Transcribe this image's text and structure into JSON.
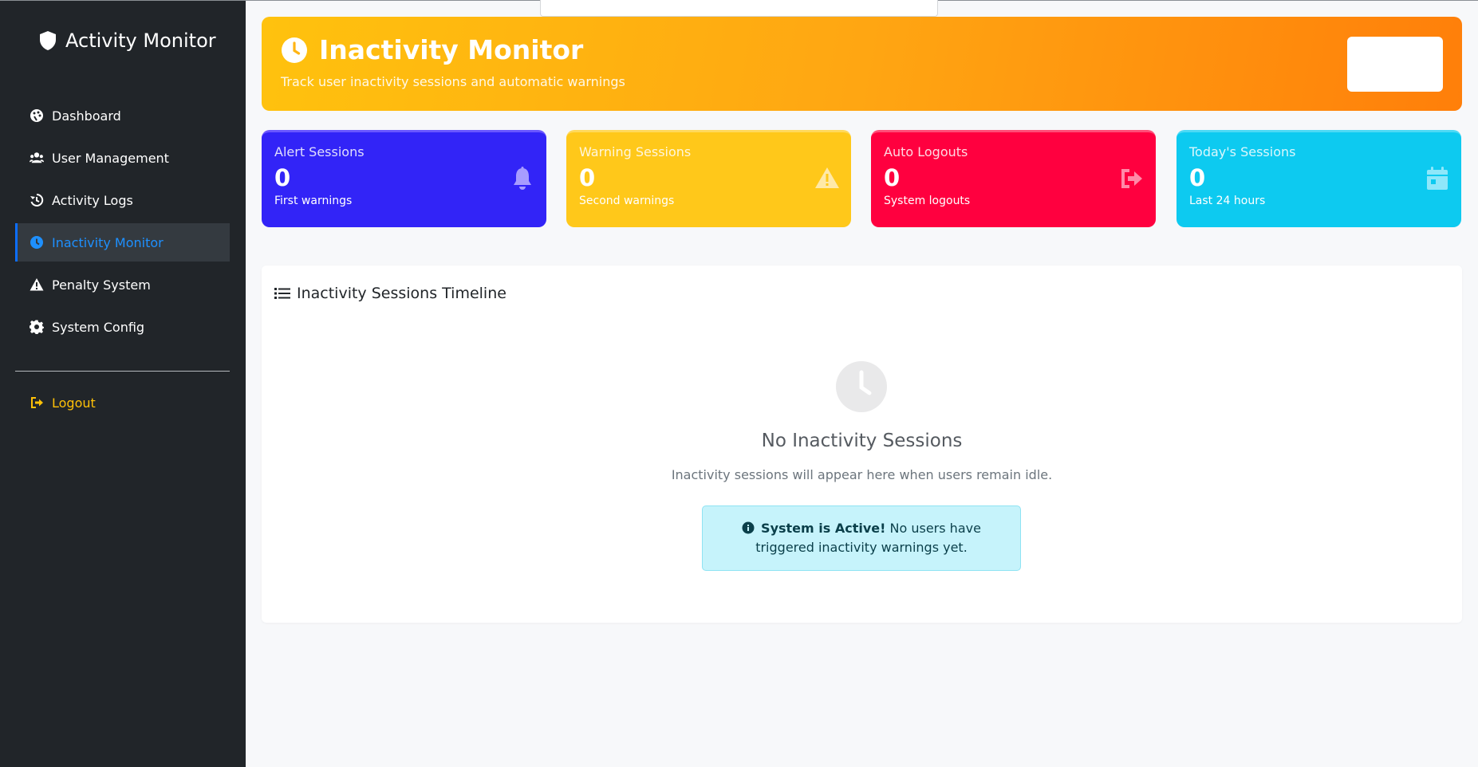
{
  "sidebar": {
    "brand": "Activity Monitor",
    "items": [
      {
        "label": "Dashboard",
        "icon": "palette-dashboard-icon"
      },
      {
        "label": "User Management",
        "icon": "users-icon"
      },
      {
        "label": "Activity Logs",
        "icon": "history-icon"
      },
      {
        "label": "Inactivity Monitor",
        "icon": "clock-icon",
        "active": true
      },
      {
        "label": "Penalty System",
        "icon": "warning-icon"
      },
      {
        "label": "System Config",
        "icon": "gear-icon"
      }
    ],
    "logout": "Logout"
  },
  "header": {
    "title": "Inactivity Monitor",
    "subtitle": "Track user inactivity sessions and automatic warnings"
  },
  "cards": [
    {
      "label": "Alert Sessions",
      "value": "0",
      "sub": "First warnings",
      "icon": "bell-icon",
      "color": "#3224f7"
    },
    {
      "label": "Warning Sessions",
      "value": "0",
      "sub": "Second warnings",
      "icon": "warning-icon",
      "color": "#ffc81a"
    },
    {
      "label": "Auto Logouts",
      "value": "0",
      "sub": "System logouts",
      "icon": "logout-icon",
      "color": "#ff003f"
    },
    {
      "label": "Today's Sessions",
      "value": "0",
      "sub": "Last 24 hours",
      "icon": "calendar-icon",
      "color": "#0dcaf0"
    }
  ],
  "timeline": {
    "title": "Inactivity Sessions Timeline",
    "empty_title": "No Inactivity Sessions",
    "empty_text": "Inactivity sessions will appear here when users remain idle.",
    "alert_strong": "System is Active!",
    "alert_text": " No users have triggered inactivity warnings yet."
  },
  "colors": {
    "sidebar_bg": "#212529",
    "active_link": "#1e90ff",
    "logout": "#ffc107"
  }
}
